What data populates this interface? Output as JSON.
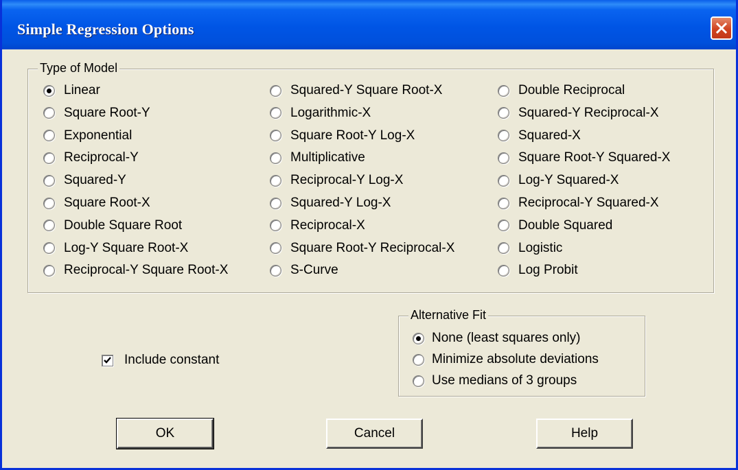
{
  "window": {
    "title": "Simple Regression Options"
  },
  "model_group": {
    "legend": "Type of Model",
    "columns": [
      [
        {
          "label": "Linear",
          "checked": true
        },
        {
          "label": "Square Root-Y",
          "checked": false
        },
        {
          "label": "Exponential",
          "checked": false
        },
        {
          "label": "Reciprocal-Y",
          "checked": false
        },
        {
          "label": "Squared-Y",
          "checked": false
        },
        {
          "label": "Square Root-X",
          "checked": false
        },
        {
          "label": "Double Square Root",
          "checked": false
        },
        {
          "label": "Log-Y Square Root-X",
          "checked": false
        },
        {
          "label": "Reciprocal-Y Square Root-X",
          "checked": false
        }
      ],
      [
        {
          "label": "Squared-Y Square Root-X",
          "checked": false
        },
        {
          "label": "Logarithmic-X",
          "checked": false
        },
        {
          "label": "Square Root-Y Log-X",
          "checked": false
        },
        {
          "label": "Multiplicative",
          "checked": false
        },
        {
          "label": "Reciprocal-Y Log-X",
          "checked": false
        },
        {
          "label": "Squared-Y Log-X",
          "checked": false
        },
        {
          "label": "Reciprocal-X",
          "checked": false
        },
        {
          "label": "Square Root-Y Reciprocal-X",
          "checked": false
        },
        {
          "label": "S-Curve",
          "checked": false
        }
      ],
      [
        {
          "label": "Double Reciprocal",
          "checked": false
        },
        {
          "label": "Squared-Y Reciprocal-X",
          "checked": false
        },
        {
          "label": "Squared-X",
          "checked": false
        },
        {
          "label": "Square Root-Y Squared-X",
          "checked": false
        },
        {
          "label": "Log-Y Squared-X",
          "checked": false
        },
        {
          "label": "Reciprocal-Y Squared-X",
          "checked": false
        },
        {
          "label": "Double Squared",
          "checked": false
        },
        {
          "label": "Logistic",
          "checked": false
        },
        {
          "label": "Log Probit",
          "checked": false
        }
      ]
    ]
  },
  "include_constant": {
    "label": "Include constant",
    "checked": true
  },
  "alt_fit_group": {
    "legend": "Alternative Fit",
    "options": [
      {
        "label": "None (least squares only)",
        "checked": true
      },
      {
        "label": "Minimize absolute deviations",
        "checked": false
      },
      {
        "label": "Use medians of 3 groups",
        "checked": false
      }
    ]
  },
  "buttons": {
    "ok": "OK",
    "cancel": "Cancel",
    "help": "Help"
  }
}
